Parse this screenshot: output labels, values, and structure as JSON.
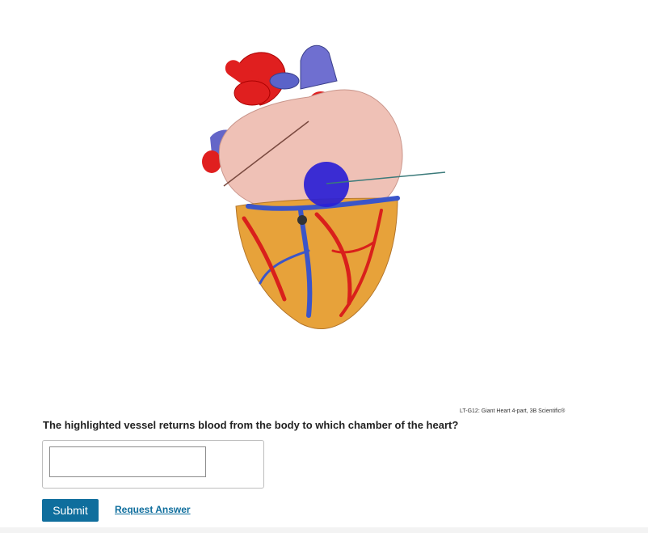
{
  "figure": {
    "credit": "LT-G12: Giant Heart 4-part, 3B Scientific®",
    "image_icon": "heart-model-image",
    "highlight_color": "#2a1fd6"
  },
  "question": {
    "text": "The highlighted vessel returns blood from the body to which chamber of the heart?"
  },
  "answer": {
    "value": "",
    "placeholder": ""
  },
  "actions": {
    "submit_label": "Submit",
    "request_label": "Request Answer"
  },
  "colors": {
    "accent": "#0f6e9d"
  }
}
